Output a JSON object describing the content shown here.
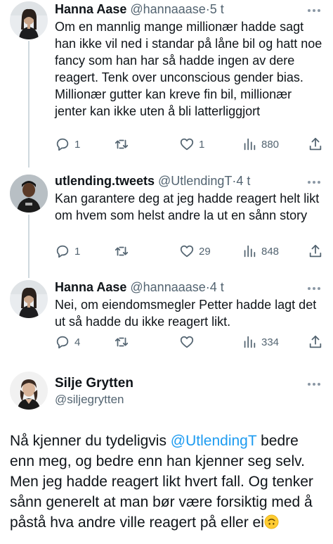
{
  "replies": [
    {
      "name": "Hanna Aase",
      "handle": "@hannaaase",
      "separator": "·",
      "time": "5 t",
      "text": "Om en mannlig mange millionær hadde sagt han ikke vil ned i standar på låne bil og hatt noe fancy som han har så hadde ingen av dere reagert. Tenk over unconscious gender bias. Millionær gutter kan kreve fin bil, millionær jenter kan ikke uten å bli latterliggjort",
      "reply_count": "1",
      "retweet_count": "",
      "like_count": "1",
      "view_count": "880"
    },
    {
      "name": "utlending.tweets",
      "handle": "@UtlendingT",
      "separator": "·",
      "time": "4 t",
      "text": "Kan garantere deg at jeg hadde reagert helt likt om hvem som helst andre la ut en sånn story",
      "reply_count": "1",
      "retweet_count": "",
      "like_count": "29",
      "view_count": "848"
    },
    {
      "name": "Hanna Aase",
      "handle": "@hannaaase",
      "separator": "·",
      "time": "4 t",
      "text": "Nei, om eiendomsmegler Petter hadde lagt det ut så hadde du ikke reagert likt.",
      "reply_count": "4",
      "retweet_count": "",
      "like_count": "",
      "view_count": "334"
    }
  ],
  "main_tweet": {
    "name": "Silje Grytten",
    "handle": "@siljegrytten",
    "text_before": "Nå kjenner du tydeligvis ",
    "mention": "@UtlendingT",
    "text_after": " bedre enn meg, og bedre enn han kjenner seg selv. Men jeg hadde reagert likt hvert fall. Og tenker sånn generelt at man bør være forsiktig med å påstå hva andre ville reagert på eller ei",
    "emoji": "upside-down-face-emoji"
  },
  "icons": {
    "reply": "reply-icon",
    "retweet": "retweet-icon",
    "like": "heart-icon",
    "views": "views-chart-icon",
    "share": "share-icon",
    "more": "more-dots-icon"
  },
  "colors": {
    "text": "#0f1419",
    "secondary": "#536471",
    "link": "#1d9bf0",
    "thread_line": "#cfd9de",
    "background": "#ffffff"
  }
}
